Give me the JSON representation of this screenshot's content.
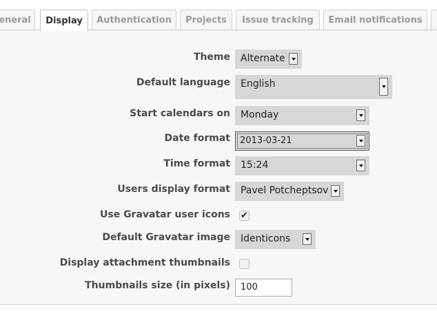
{
  "tabs": [
    {
      "label": "eneral"
    },
    {
      "label": "Display"
    },
    {
      "label": "Authentication"
    },
    {
      "label": "Projects"
    },
    {
      "label": "Issue tracking"
    },
    {
      "label": "Email notifications"
    }
  ],
  "form": {
    "theme": {
      "label": "Theme",
      "value": "Alternate"
    },
    "default_language": {
      "label": "Default language",
      "value": "English"
    },
    "start_calendars": {
      "label": "Start calendars on",
      "value": "Monday"
    },
    "date_format": {
      "label": "Date format",
      "value": "2013-03-21"
    },
    "time_format": {
      "label": "Time format",
      "value": "15:24"
    },
    "users_display_format": {
      "label": "Users display format",
      "value": "Pavel Potcheptsov"
    },
    "use_gravatar": {
      "label": "Use Gravatar user icons",
      "checked": true,
      "mark": "✔"
    },
    "default_gravatar": {
      "label": "Default Gravatar image",
      "value": "Identicons"
    },
    "attachment_thumbnails": {
      "label": "Display attachment thumbnails",
      "checked": false
    },
    "thumbnails_size": {
      "label": "Thumbnails size (in pixels)",
      "value": "100"
    }
  },
  "icons": {
    "dropdown": "chevron-down-icon",
    "check": "checkmark-icon"
  },
  "colors": {
    "panel": "#f7f7f7",
    "select": "#d7d7d7",
    "label": "#4a4a4a"
  }
}
